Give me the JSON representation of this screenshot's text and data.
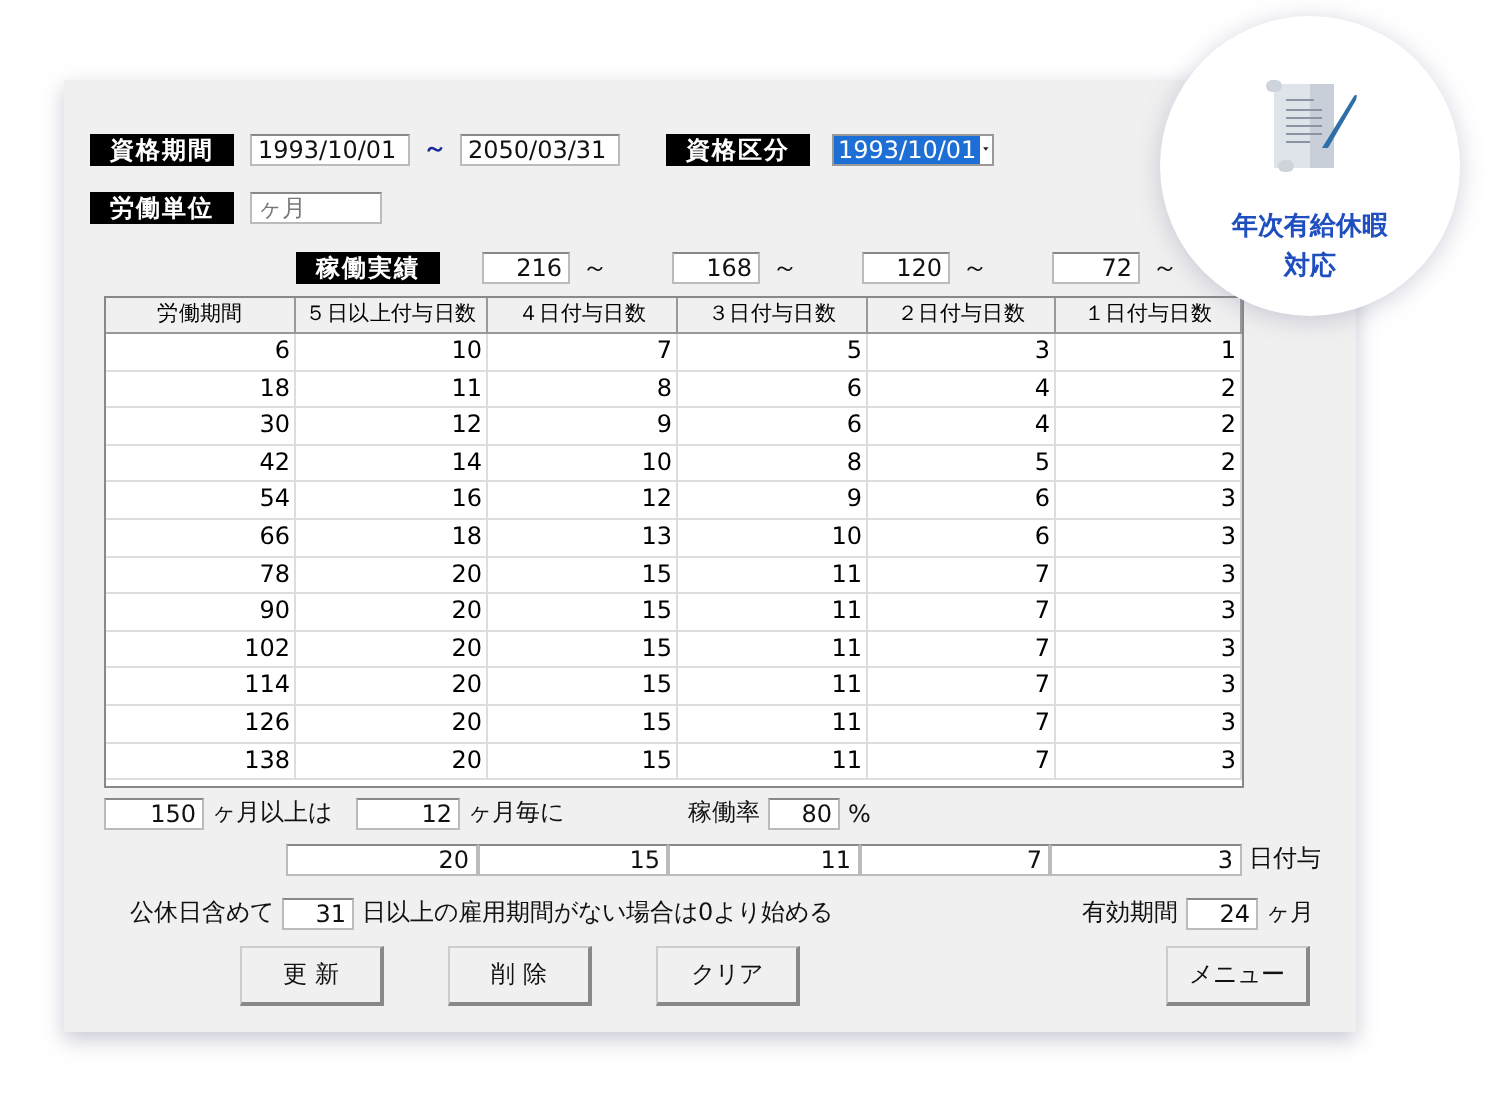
{
  "badge": {
    "lines": [
      "年次有給休暇",
      "対応"
    ]
  },
  "period": {
    "label": "資格期間",
    "from": "1993/10/01",
    "separator": "～",
    "to": "2050/03/31"
  },
  "qualification_class": {
    "label": "資格区分",
    "value": "1993/10/01",
    "highlighted": true
  },
  "work_unit": {
    "label": "労働単位",
    "placeholder": "ヶ月"
  },
  "attendance": {
    "label": "稼働実績",
    "thresholds": [
      {
        "value": "216",
        "suffix": "～"
      },
      {
        "value": "168",
        "suffix": "～"
      },
      {
        "value": "120",
        "suffix": "～"
      },
      {
        "value": "72",
        "suffix": "～"
      }
    ]
  },
  "table": {
    "columns": [
      "労働期間",
      "５日以上付与日数",
      "４日付与日数",
      "３日付与日数",
      "２日付与日数",
      "１日付与日数"
    ],
    "rows": [
      [
        "6",
        "10",
        "7",
        "5",
        "3",
        "1"
      ],
      [
        "18",
        "11",
        "8",
        "6",
        "4",
        "2"
      ],
      [
        "30",
        "12",
        "9",
        "6",
        "4",
        "2"
      ],
      [
        "42",
        "14",
        "10",
        "8",
        "5",
        "2"
      ],
      [
        "54",
        "16",
        "12",
        "9",
        "6",
        "3"
      ],
      [
        "66",
        "18",
        "13",
        "10",
        "6",
        "3"
      ],
      [
        "78",
        "20",
        "15",
        "11",
        "7",
        "3"
      ],
      [
        "90",
        "20",
        "15",
        "11",
        "7",
        "3"
      ],
      [
        "102",
        "20",
        "15",
        "11",
        "7",
        "3"
      ],
      [
        "114",
        "20",
        "15",
        "11",
        "7",
        "3"
      ],
      [
        "126",
        "20",
        "15",
        "11",
        "7",
        "3"
      ],
      [
        "138",
        "20",
        "15",
        "11",
        "7",
        "3"
      ]
    ]
  },
  "after": {
    "months": "150",
    "months_label": "ヶ月以上は",
    "every": "12",
    "every_label": "ヶ月毎に",
    "rate_label": "稼働率",
    "rate": "80",
    "rate_unit": "%"
  },
  "grants": {
    "values": [
      "20",
      "15",
      "11",
      "7",
      "3"
    ],
    "label": "日付与"
  },
  "holiday": {
    "prefix": "公休日含めて",
    "days": "31",
    "suffix": "日以上の雇用期間がない場合は0より始める"
  },
  "validity": {
    "label": "有効期間",
    "value": "24",
    "unit": "ヶ月"
  },
  "buttons": [
    {
      "label": "更 新",
      "kind": "left"
    },
    {
      "label": "削 除",
      "kind": "left"
    },
    {
      "label": "クリア",
      "kind": "left"
    },
    {
      "label": "メニュー",
      "kind": "right"
    }
  ]
}
